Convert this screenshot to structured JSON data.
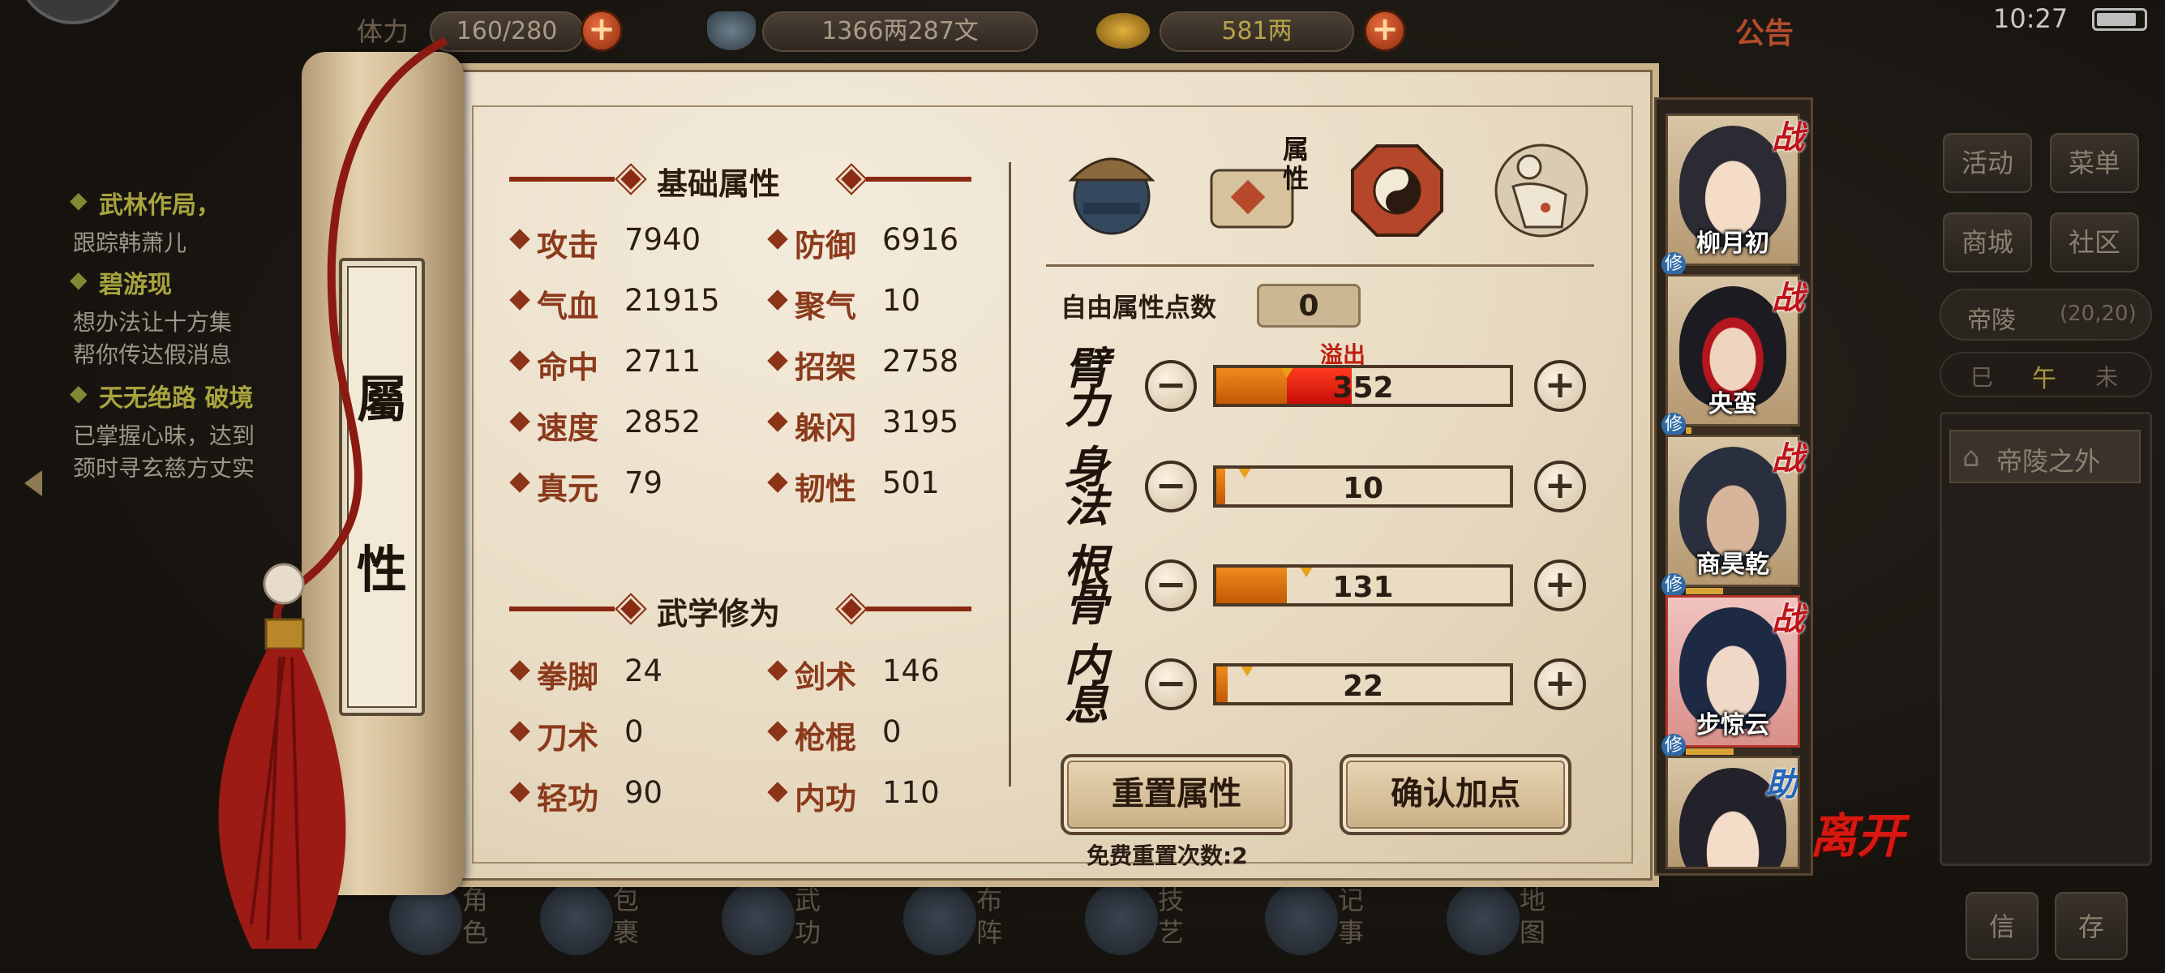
{
  "status_bar": {
    "time": "10:27"
  },
  "top_bar": {
    "stamina_label": "体力",
    "stamina": "160/280",
    "silver": "1366两287文",
    "gold": "581两",
    "announcement": "公告"
  },
  "quest_log": [
    {
      "title": "武林作局，",
      "desc": [
        "跟踪韩萧儿"
      ]
    },
    {
      "title": "碧游现",
      "desc": [
        "想办法让十方集",
        "帮你传达假消息"
      ]
    },
    {
      "title": "天无绝路 破境",
      "desc": [
        "已掌握心昧，达到",
        "颈时寻玄慈方丈实"
      ]
    }
  ],
  "scroll_title": [
    "屬",
    "性"
  ],
  "basic_attrs": {
    "header": "基础属性",
    "items": [
      {
        "label": "攻击",
        "value": "7940"
      },
      {
        "label": "防御",
        "value": "6916"
      },
      {
        "label": "气血",
        "value": "21915"
      },
      {
        "label": "聚气",
        "value": "10"
      },
      {
        "label": "命中",
        "value": "2711"
      },
      {
        "label": "招架",
        "value": "2758"
      },
      {
        "label": "速度",
        "value": "2852"
      },
      {
        "label": "躲闪",
        "value": "3195"
      },
      {
        "label": "真元",
        "value": "79"
      },
      {
        "label": "韧性",
        "value": "501"
      }
    ]
  },
  "martial_arts": {
    "header": "武学修为",
    "items": [
      {
        "label": "拳脚",
        "value": "24"
      },
      {
        "label": "剑术",
        "value": "146"
      },
      {
        "label": "刀术",
        "value": "0"
      },
      {
        "label": "枪棍",
        "value": "0"
      },
      {
        "label": "轻功",
        "value": "90"
      },
      {
        "label": "内功",
        "value": "110"
      }
    ]
  },
  "tabs": {
    "attributes_tab_label": "属性"
  },
  "free_points": {
    "label": "自由属性点数",
    "value": "0"
  },
  "overflow_label": "溢出",
  "attributes": [
    {
      "label": "臂力",
      "value": "352",
      "fill": 0.24,
      "overflow": 0.22
    },
    {
      "label": "身法",
      "value": "10",
      "fill": 0.03,
      "overflow": 0
    },
    {
      "label": "根骨",
      "value": "131",
      "fill": 0.24,
      "overflow": 0
    },
    {
      "label": "内息",
      "value": "22",
      "fill": 0.04,
      "overflow": 0
    }
  ],
  "buttons": {
    "reset": "重置属性",
    "confirm": "确认加点",
    "free_reset_count": "免费重置次数:2",
    "leave": "离开"
  },
  "party": [
    {
      "name": "柳月初",
      "badge": "战",
      "xp": 0.0
    },
    {
      "name": "央蛮",
      "badge": "战",
      "xp": 0.05
    },
    {
      "name": "商昊乾",
      "badge": "战",
      "xp": 0.35
    },
    {
      "name": "步惊云",
      "badge": "战",
      "xp": 0.45
    },
    {
      "name": "",
      "badge": "助",
      "xp": 0.0
    }
  ],
  "right_sidebar": {
    "activity": "活动",
    "menu": "菜单",
    "shop": "商城",
    "community": "社区",
    "location": "帝陵",
    "coords": "(20,20)",
    "time_cycle": [
      "巳",
      "午",
      "未"
    ],
    "map_entry": "帝陵之外",
    "mail": "信",
    "save": "存"
  },
  "bottom_nav": [
    {
      "label": "角色"
    },
    {
      "label": "包裹"
    },
    {
      "label": "武功"
    },
    {
      "label": "布阵"
    },
    {
      "label": "技艺"
    },
    {
      "label": "记事"
    },
    {
      "label": "地图"
    }
  ],
  "colors": {
    "accent_red": "#8b2a12",
    "stat_label": "#8b3a1c",
    "bar_fill": "#f08a1c",
    "bar_overflow": "#ff3a1e"
  }
}
